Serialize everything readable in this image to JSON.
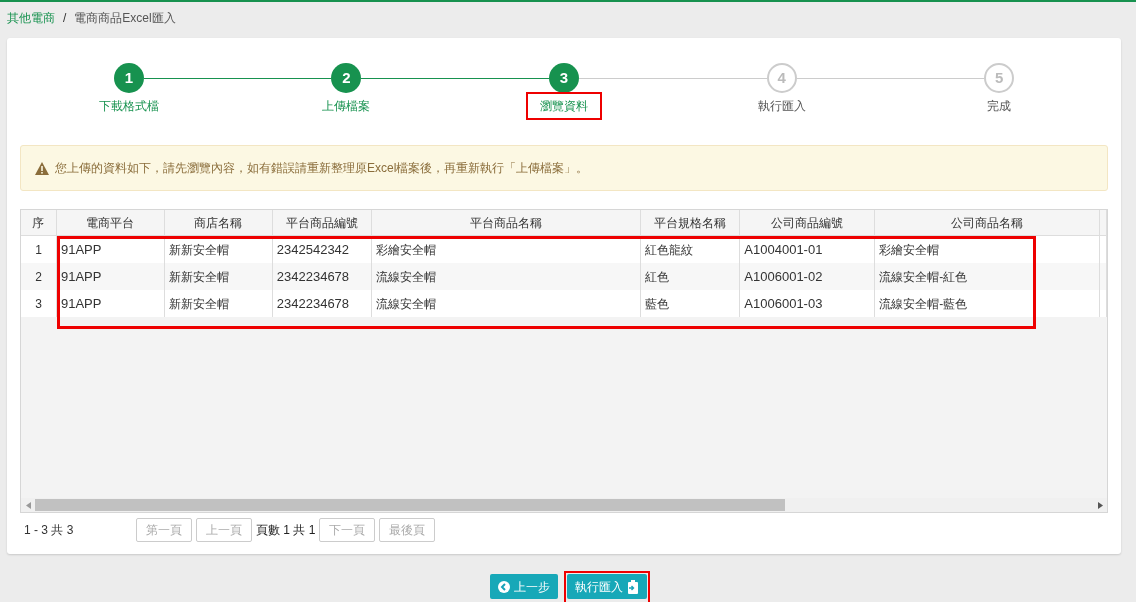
{
  "breadcrumb_separator": "/",
  "breadcrumb": [
    {
      "label": "其他電商",
      "link": true
    },
    {
      "label": "電商商品Excel匯入",
      "link": false
    }
  ],
  "steps": [
    {
      "number": "1",
      "label": "下載格式檔",
      "done": true,
      "highlighted": false
    },
    {
      "number": "2",
      "label": "上傳檔案",
      "done": true,
      "highlighted": false
    },
    {
      "number": "3",
      "label": "瀏覽資料",
      "done": true,
      "highlighted": true
    },
    {
      "number": "4",
      "label": "執行匯入",
      "done": false,
      "highlighted": false
    },
    {
      "number": "5",
      "label": "完成",
      "done": false,
      "highlighted": false
    }
  ],
  "alert": "您上傳的資料如下，請先瀏覽內容，如有錯誤請重新整理原Excel檔案後，再重新執行「上傳檔案」。",
  "table": {
    "highlighted": true,
    "columns": [
      "序",
      "電商平台",
      "商店名稱",
      "平台商品編號",
      "平台商品名稱",
      "平台規格名稱",
      "公司商品編號",
      "公司商品名稱"
    ],
    "rows": [
      [
        "1",
        "91APP",
        "新新安全帽",
        "2342542342",
        "彩繪安全帽",
        "紅色龍紋",
        "A1004001-01",
        "彩繪安全帽"
      ],
      [
        "2",
        "91APP",
        "新新安全帽",
        "2342234678",
        "流線安全帽",
        "紅色",
        "A1006001-02",
        "流線安全帽-紅色"
      ],
      [
        "3",
        "91APP",
        "新新安全帽",
        "2342234678",
        "流線安全帽",
        "藍色",
        "A1006001-03",
        "流線安全帽-藍色"
      ]
    ]
  },
  "pager": {
    "summary": "1 - 3 共 3",
    "first": "第一頁",
    "prev": "上一頁",
    "page_info": "頁數 1 共 1",
    "next": "下一頁",
    "last": "最後頁"
  },
  "buttons": [
    {
      "label": "上一步",
      "kind": "back",
      "highlighted": false
    },
    {
      "label": "執行匯入",
      "kind": "import",
      "highlighted": true
    }
  ]
}
